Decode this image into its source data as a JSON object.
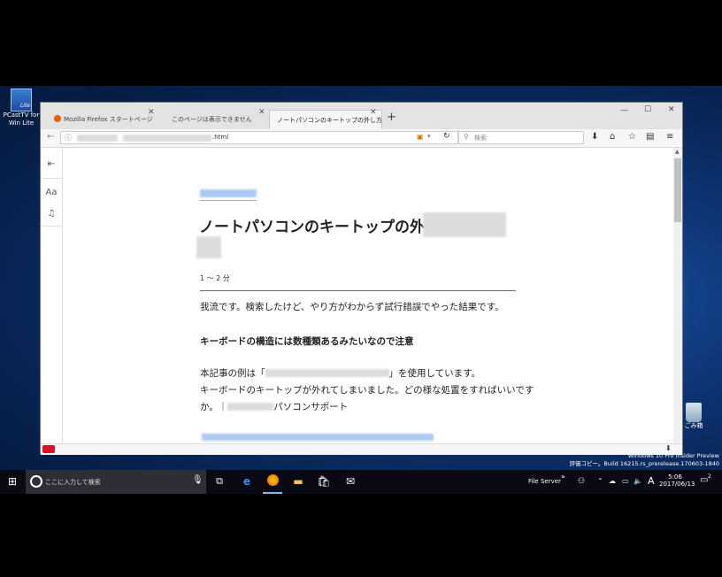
{
  "desktop": {
    "icons": [
      {
        "label": "PCastTV for Win Lite",
        "badge": "Lite"
      },
      {
        "label": "ごみ箱"
      }
    ],
    "watermark": {
      "line1": "Windows 10 Pro Insider Preview",
      "line2": "評価コピー。Build 16215.rs_prerelease.170603-1840"
    }
  },
  "browser": {
    "tabs": [
      {
        "label": "Mozilla Firefox スタートページ",
        "active": false
      },
      {
        "label": "このページは表示できません",
        "active": false
      },
      {
        "label": "ノートパソコンのキートップの外し方 -",
        "active": true
      }
    ],
    "new_tab_label": "+",
    "window_controls": {
      "minimize": "—",
      "maximize": "☐",
      "close": "✕"
    },
    "url": ".html",
    "search_placeholder": "検索"
  },
  "reader_sidebar": {
    "font_button": "Aa"
  },
  "article": {
    "title": "ノートパソコンのキートップの外し方",
    "read_time": "1 〜 2 分",
    "paragraph1": "我流です。検索したけど、やり方がわからず試行錯誤でやった結果です。",
    "heading1": "キーボードの構造には数種類あるみたいなので注意",
    "p2_line1_a": "本記事の例は「",
    "p2_line1_b": "」を使用しています。",
    "p2_line2": "キーボードのキートップが外れてしまいました。どの様な処置をすればいいです",
    "p2_line3_a": "か。｜",
    "p2_line3_b": "パソコンサポート"
  },
  "taskbar": {
    "search_placeholder": "ここに入力して検索",
    "file_server": "File Server",
    "ime": "A",
    "time": "5:06",
    "date": "2017/06/13",
    "notification_count": "2"
  }
}
